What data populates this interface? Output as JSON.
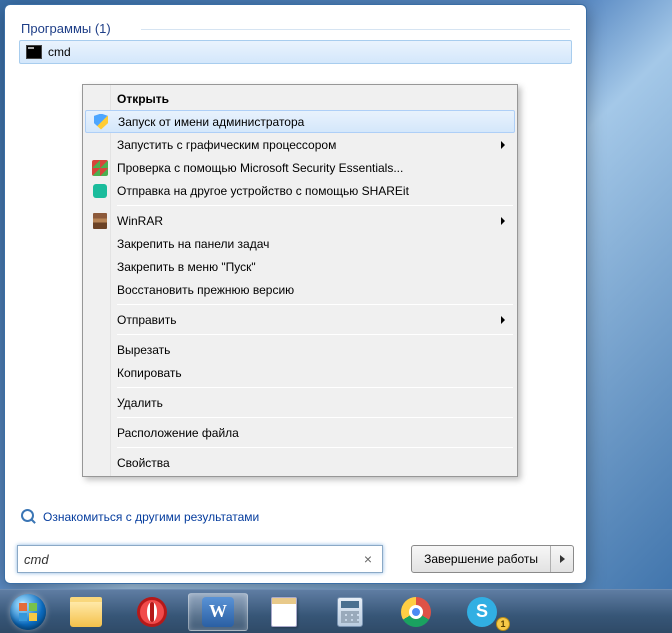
{
  "section_header": "Программы (1)",
  "result": {
    "label": "cmd"
  },
  "context_menu": {
    "items": [
      {
        "label": "Открыть",
        "bold": true
      },
      {
        "label": "Запуск от имени администратора",
        "icon": "shield",
        "highlight": true
      },
      {
        "label": "Запустить с графическим процессором",
        "submenu": true
      },
      {
        "label": "Проверка с помощью Microsoft Security Essentials...",
        "icon": "win"
      },
      {
        "label": "Отправка на другое устройство с помощью SHAREit",
        "icon": "teal"
      },
      {
        "sep": true
      },
      {
        "label": "WinRAR",
        "icon": "rar",
        "submenu": true
      },
      {
        "label": "Закрепить на панели задач"
      },
      {
        "label": "Закрепить в меню \"Пуск\""
      },
      {
        "label": "Восстановить прежнюю версию"
      },
      {
        "sep": true
      },
      {
        "label": "Отправить",
        "submenu": true
      },
      {
        "sep": true
      },
      {
        "label": "Вырезать"
      },
      {
        "label": "Копировать"
      },
      {
        "sep": true
      },
      {
        "label": "Удалить"
      },
      {
        "sep": true
      },
      {
        "label": "Расположение файла"
      },
      {
        "sep": true
      },
      {
        "label": "Свойства"
      }
    ]
  },
  "see_more": "Ознакомиться с другими результатами",
  "search_value": "cmd",
  "shutdown_label": "Завершение работы",
  "taskbar": {
    "skype_badge": "1",
    "word_letter": "W",
    "skype_letter": "S"
  }
}
